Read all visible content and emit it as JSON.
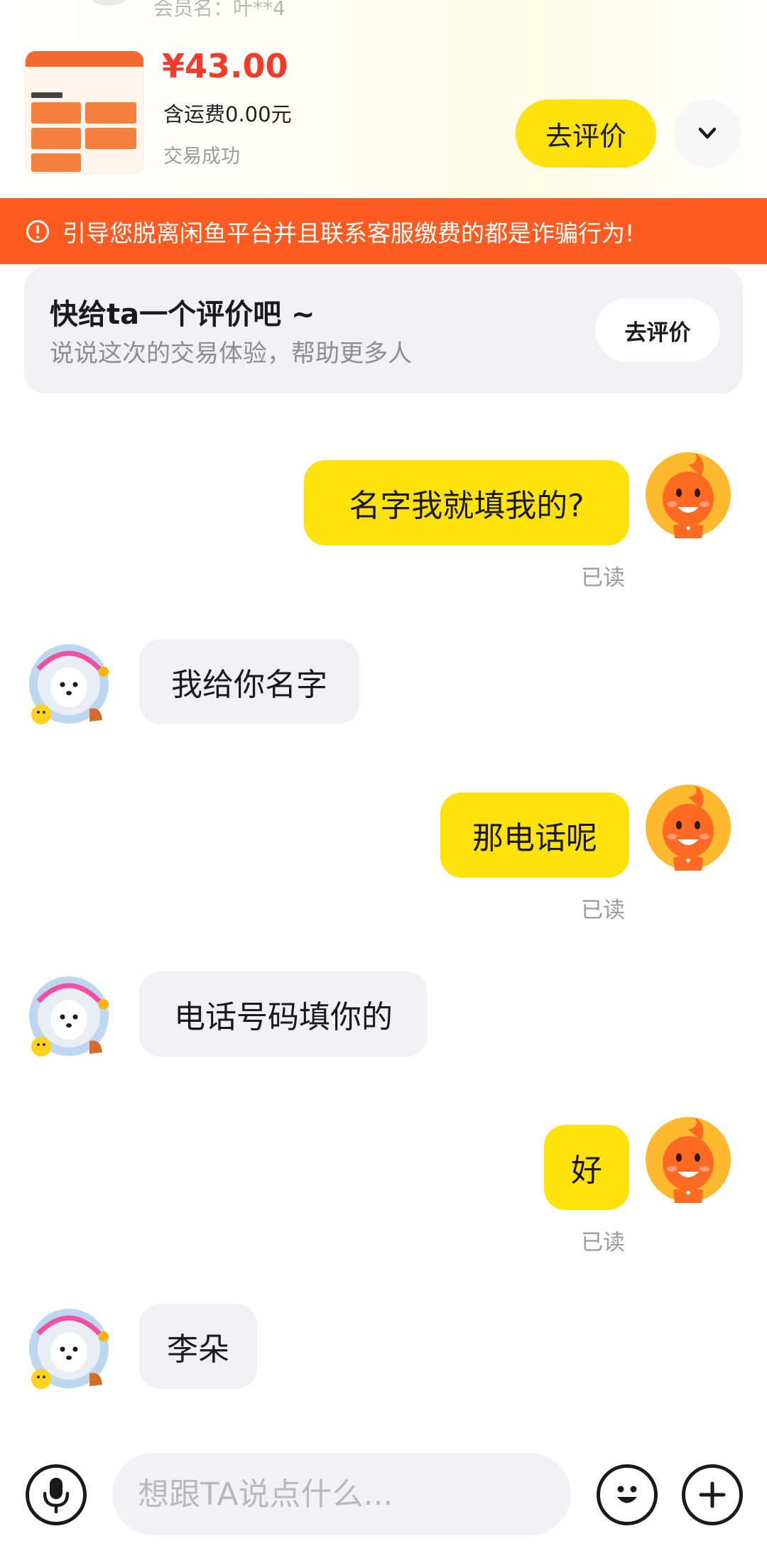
{
  "order": {
    "seller_label": "会员名：叶**4",
    "price": "¥43.00",
    "shipping": "含运费0.00元",
    "status": "交易成功",
    "review_button": "去评价"
  },
  "warning": {
    "text": "引导您脱离闲鱼平台并且联系客服缴费的都是诈骗行为!"
  },
  "review_prompt": {
    "title": "快给ta一个评价吧 ~",
    "subtitle": "说说这次的交易体验，帮助更多人",
    "button": "去评价"
  },
  "messages": [
    {
      "from": "me",
      "text": "名字我就填我的?",
      "read": "已读"
    },
    {
      "from": "them",
      "text": "我给你名字"
    },
    {
      "from": "me",
      "text": "那电话呢",
      "read": "已读"
    },
    {
      "from": "them",
      "text": "电话号码填你的"
    },
    {
      "from": "me",
      "text": "好",
      "read": "已读"
    },
    {
      "from": "them",
      "text": "李朵"
    }
  ],
  "input": {
    "placeholder": "想跟TA说点什么..."
  },
  "icons": {
    "expand": "chevron-down-icon",
    "warning": "alert-circle-icon",
    "mic": "microphone-icon",
    "emoji": "emoji-icon",
    "plus": "plus-icon"
  },
  "colors": {
    "accent_yellow": "#ffe20c",
    "warning_orange": "#ff5a1f",
    "price_red": "#f23b2c"
  }
}
